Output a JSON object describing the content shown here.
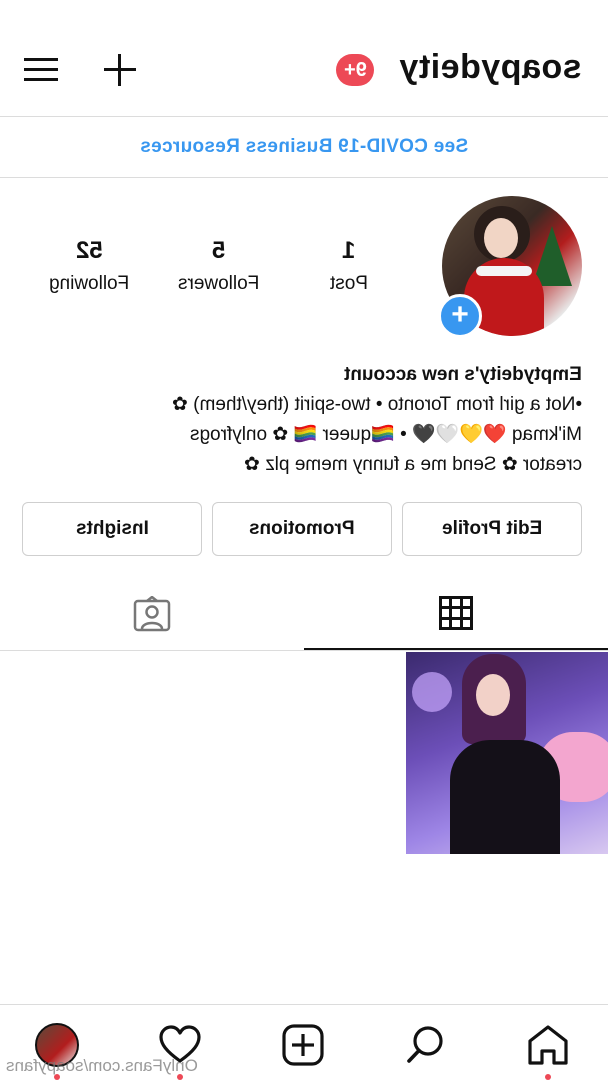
{
  "header": {
    "username": "soapydeity",
    "notification_badge": "9+"
  },
  "banner": {
    "text": "See COVID-19 Business Resources"
  },
  "stats": {
    "posts": {
      "count": "1",
      "label": "Post"
    },
    "followers": {
      "count": "5",
      "label": "Followers"
    },
    "following": {
      "count": "52",
      "label": "Following"
    }
  },
  "bio": {
    "name": "Emptydeity's new account",
    "lines": [
      "•Not a girl from Toronto • two-spirit (they/them) ✿",
      "Mi'kmaq ❤️💛🤍🖤 • 🏳️‍🌈queer 🏳️‍🌈 ✿ onlyfrogs",
      "creator ✿ Send me a funny meme plz ✿"
    ]
  },
  "buttons": {
    "edit_profile": "Edit Profile",
    "promotions": "Promotions",
    "insights": "Insights"
  },
  "watermark": "OnlyFans.com/soapyfans",
  "colors": {
    "accent_blue": "#3897f0",
    "notification_red": "#ed4956",
    "border": "#dcdcdc"
  },
  "icons": {
    "menu": "hamburger-menu-icon",
    "create": "plus-icon",
    "grid_tab": "grid-icon",
    "tagged_tab": "tagged-person-icon",
    "nav": [
      "profile-avatar-icon",
      "heart-icon",
      "new-post-icon",
      "search-icon",
      "home-icon"
    ]
  }
}
